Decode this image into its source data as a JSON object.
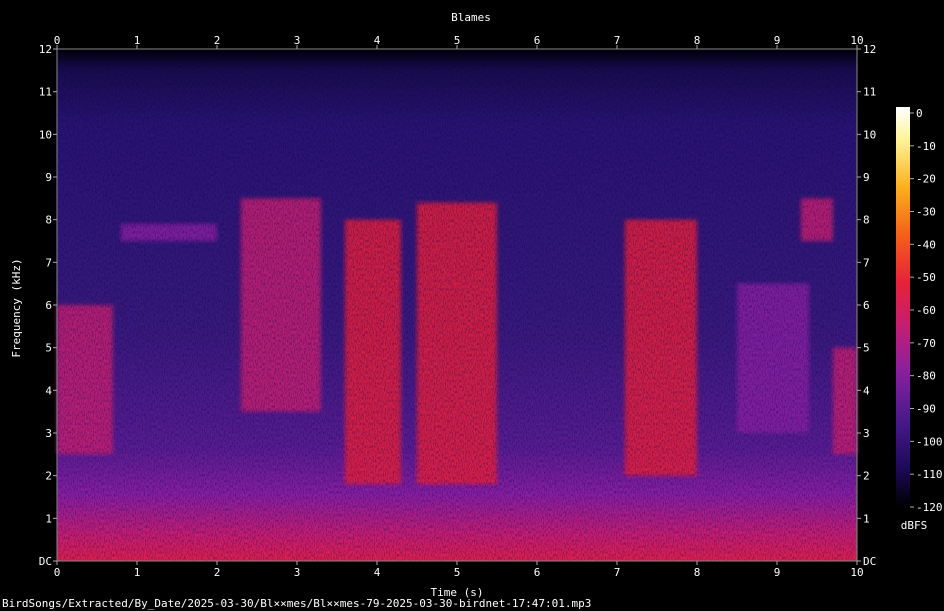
{
  "chart_data": {
    "type": "heatmap",
    "title": "Blames",
    "xlabel": "Time (s)",
    "ylabel": "Frequency (kHz)",
    "xlim": [
      0,
      10
    ],
    "ylim": [
      0,
      12
    ],
    "x_ticks": [
      "0",
      "1",
      "2",
      "3",
      "4",
      "5",
      "6",
      "7",
      "8",
      "9",
      "10"
    ],
    "y_ticks": [
      "DC",
      "1",
      "2",
      "3",
      "4",
      "5",
      "6",
      "7",
      "8",
      "9",
      "10",
      "11",
      "12"
    ],
    "colorbar": {
      "label": "dBFS",
      "ticks": [
        "0",
        "-10",
        "-20",
        "-30",
        "-40",
        "-50",
        "-60",
        "-70",
        "-80",
        "-90",
        "-100",
        "-110",
        "-120"
      ],
      "range": [
        -120,
        0
      ],
      "colormap": [
        "#000000",
        "#1e0a5a",
        "#4a1a8c",
        "#8a1f9e",
        "#c81e6e",
        "#e8203a",
        "#f5601a",
        "#fbb01e",
        "#fff59a",
        "#ffffff"
      ]
    },
    "events": [
      {
        "t_start": 0.0,
        "t_end": 0.7,
        "f_low": 2.5,
        "f_high": 6.0,
        "level_dbfs": -70
      },
      {
        "t_start": 0.8,
        "t_end": 2.0,
        "f_low": 7.5,
        "f_high": 7.9,
        "level_dbfs": -75
      },
      {
        "t_start": 2.3,
        "t_end": 3.3,
        "f_low": 3.5,
        "f_high": 8.5,
        "level_dbfs": -68
      },
      {
        "t_start": 3.6,
        "t_end": 4.3,
        "f_low": 1.8,
        "f_high": 8.0,
        "level_dbfs": -55
      },
      {
        "t_start": 4.5,
        "t_end": 5.5,
        "f_low": 1.8,
        "f_high": 8.4,
        "level_dbfs": -58
      },
      {
        "t_start": 7.1,
        "t_end": 8.0,
        "f_low": 2.0,
        "f_high": 8.0,
        "level_dbfs": -56
      },
      {
        "t_start": 8.5,
        "t_end": 9.4,
        "f_low": 3.0,
        "f_high": 6.5,
        "level_dbfs": -78
      },
      {
        "t_start": 9.3,
        "t_end": 9.7,
        "f_low": 7.5,
        "f_high": 8.5,
        "level_dbfs": -62
      },
      {
        "t_start": 9.7,
        "t_end": 10.0,
        "f_low": 2.5,
        "f_high": 5.0,
        "level_dbfs": -70
      }
    ]
  },
  "footer": {
    "path": "BirdSongs/Extracted/By_Date/2025-03-30/Bl××mes/Bl××mes-79-2025-03-30-birdnet-17:47:01.mp3"
  }
}
